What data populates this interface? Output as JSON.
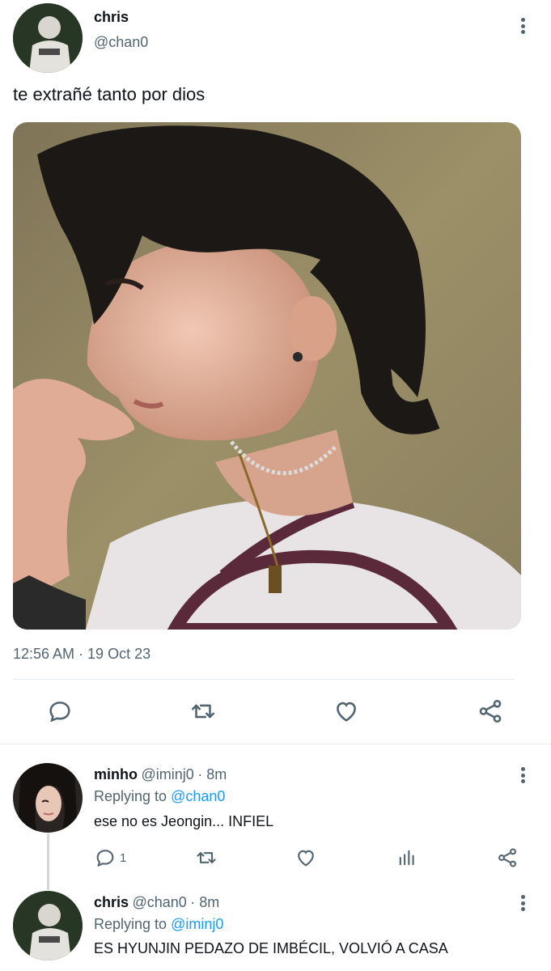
{
  "tweet": {
    "author_name": "chris",
    "author_handle": "@chan0",
    "text": "te extrañé tanto por dios",
    "timestamp": "12:56 AM · 19 Oct 23",
    "actions": [
      "reply-icon",
      "retweet-icon",
      "like-icon",
      "share-icon"
    ]
  },
  "replies": [
    {
      "name": "minho",
      "handle": "@iminj0",
      "time": "· 8m",
      "replying_label": "Replying to",
      "replying_to": "@chan0",
      "text": "ese no es Jeongin... INFIEL",
      "reply_count": "1"
    },
    {
      "name": "chris",
      "handle": "@chan0",
      "time": "· 8m",
      "replying_label": "Replying to",
      "replying_to": "@iminj0",
      "text": "ES HYUNJIN PEDAZO DE IMBÉCIL, VOLVIÓ A CASA"
    }
  ],
  "colors": {
    "accent": "#1d9bf0",
    "secondary_text": "#536471",
    "icon": "#536471"
  }
}
